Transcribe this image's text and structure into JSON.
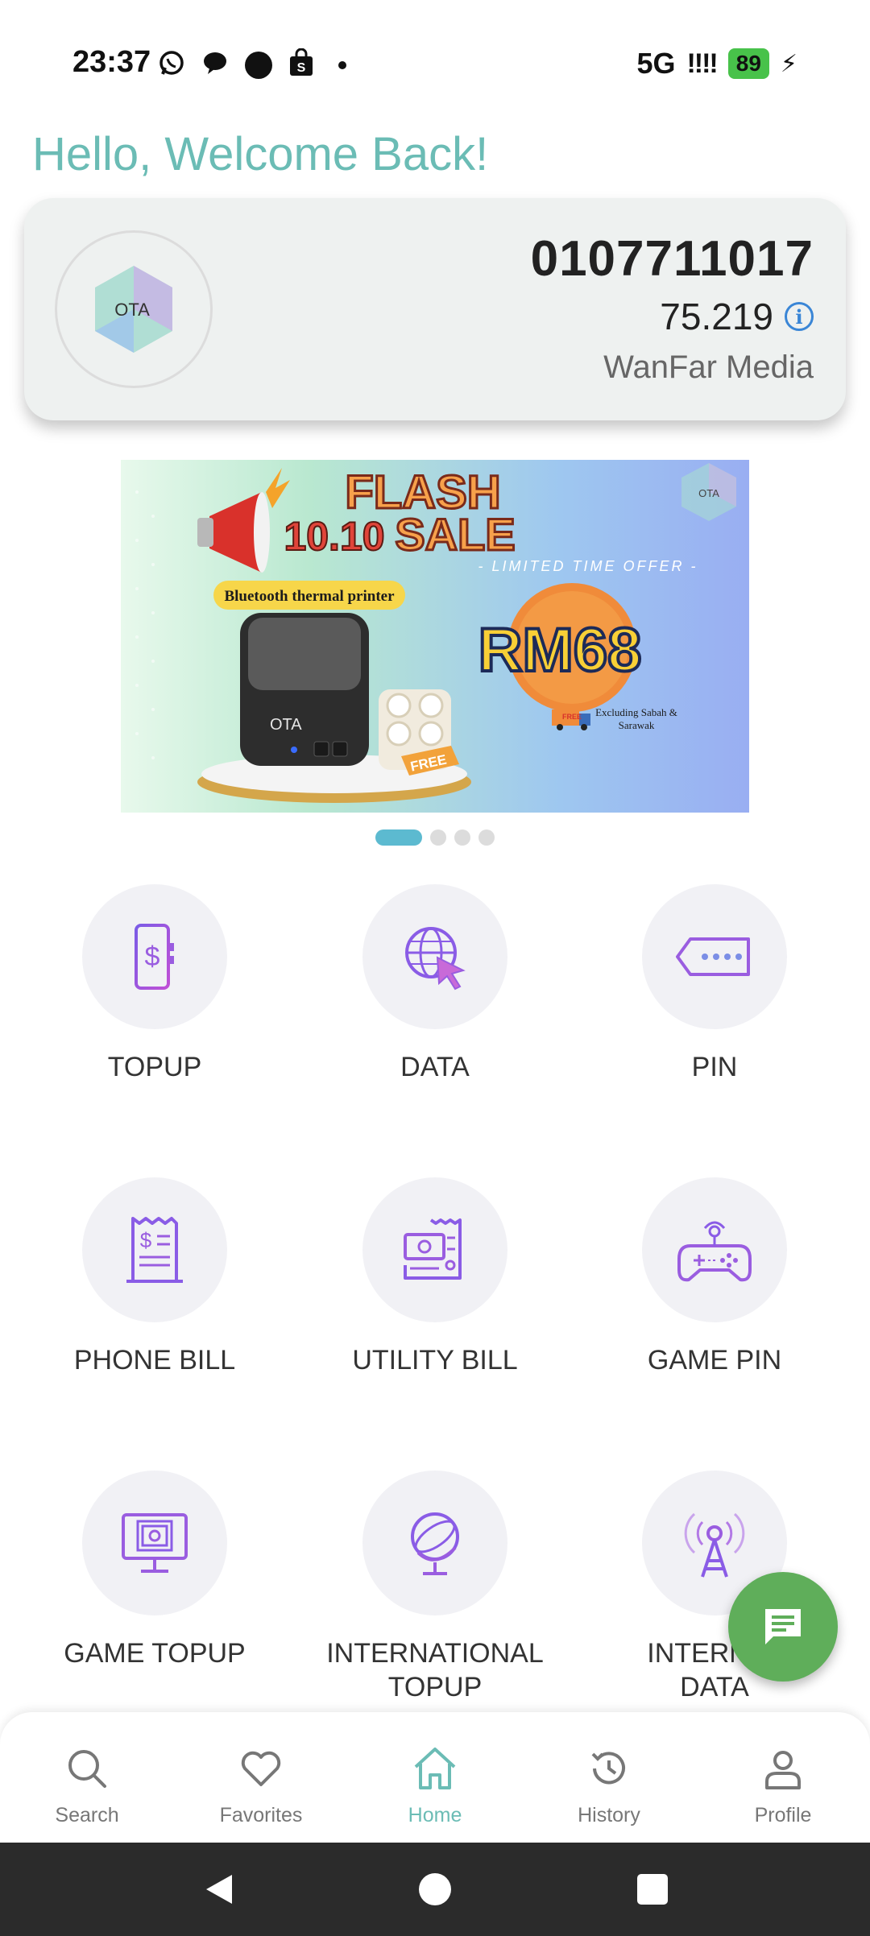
{
  "status_bar": {
    "time": "23:37",
    "network": "5G",
    "signal": "!!!!",
    "battery": "89",
    "left_icons": [
      "whatsapp-icon",
      "chat-bubble-icon",
      "circle-icon",
      "shopping-bag-icon",
      "dot-icon"
    ]
  },
  "greeting": "Hello, Welcome Back!",
  "account": {
    "number": "0107711017",
    "balance": "75.219",
    "name": "WanFar Media",
    "logo_text": "OTA"
  },
  "banner": {
    "title_line1": "FLASH",
    "title_prefix": "10.10",
    "title_line2": "SALE",
    "subtitle": "- LIMITED TIME OFFER -",
    "product": "Bluetooth thermal printer",
    "price": "RM68",
    "free_tag": "FREE",
    "shipping_badge": "FREE",
    "shipping_note_1": "Excluding Sabah &",
    "shipping_note_2": "Sarawak",
    "logo_text": "OTA",
    "slides": 4,
    "active_slide": 1
  },
  "services": [
    {
      "label": "TOPUP",
      "icon": "phone-dollar-icon"
    },
    {
      "label": "DATA",
      "icon": "globe-cursor-icon"
    },
    {
      "label": "PIN",
      "icon": "tag-icon"
    },
    {
      "label": "PHONE BILL",
      "icon": "receipt-icon"
    },
    {
      "label": "UTILITY BILL",
      "icon": "bill-icon"
    },
    {
      "label": "GAME PIN",
      "icon": "gamepad-icon"
    },
    {
      "label": "GAME TOPUP",
      "icon": "monitor-cash-icon"
    },
    {
      "label_line1": "INTERNATIONAL",
      "label_line2": "TOPUP",
      "icon": "globe-stand-icon"
    },
    {
      "label_line1": "INTERNAT",
      "label_line2": "DATA",
      "icon": "antenna-icon"
    }
  ],
  "bottom_nav": [
    {
      "label": "Search",
      "icon": "search-icon"
    },
    {
      "label": "Favorites",
      "icon": "heart-icon"
    },
    {
      "label": "Home",
      "icon": "home-icon",
      "active": true
    },
    {
      "label": "History",
      "icon": "history-icon"
    },
    {
      "label": "Profile",
      "icon": "person-icon"
    }
  ],
  "colors": {
    "accent": "#6bbcb5",
    "icon_purple": "#9a5de0",
    "fab_green": "#5fae5a",
    "tile_bg": "#f1f1f5"
  }
}
